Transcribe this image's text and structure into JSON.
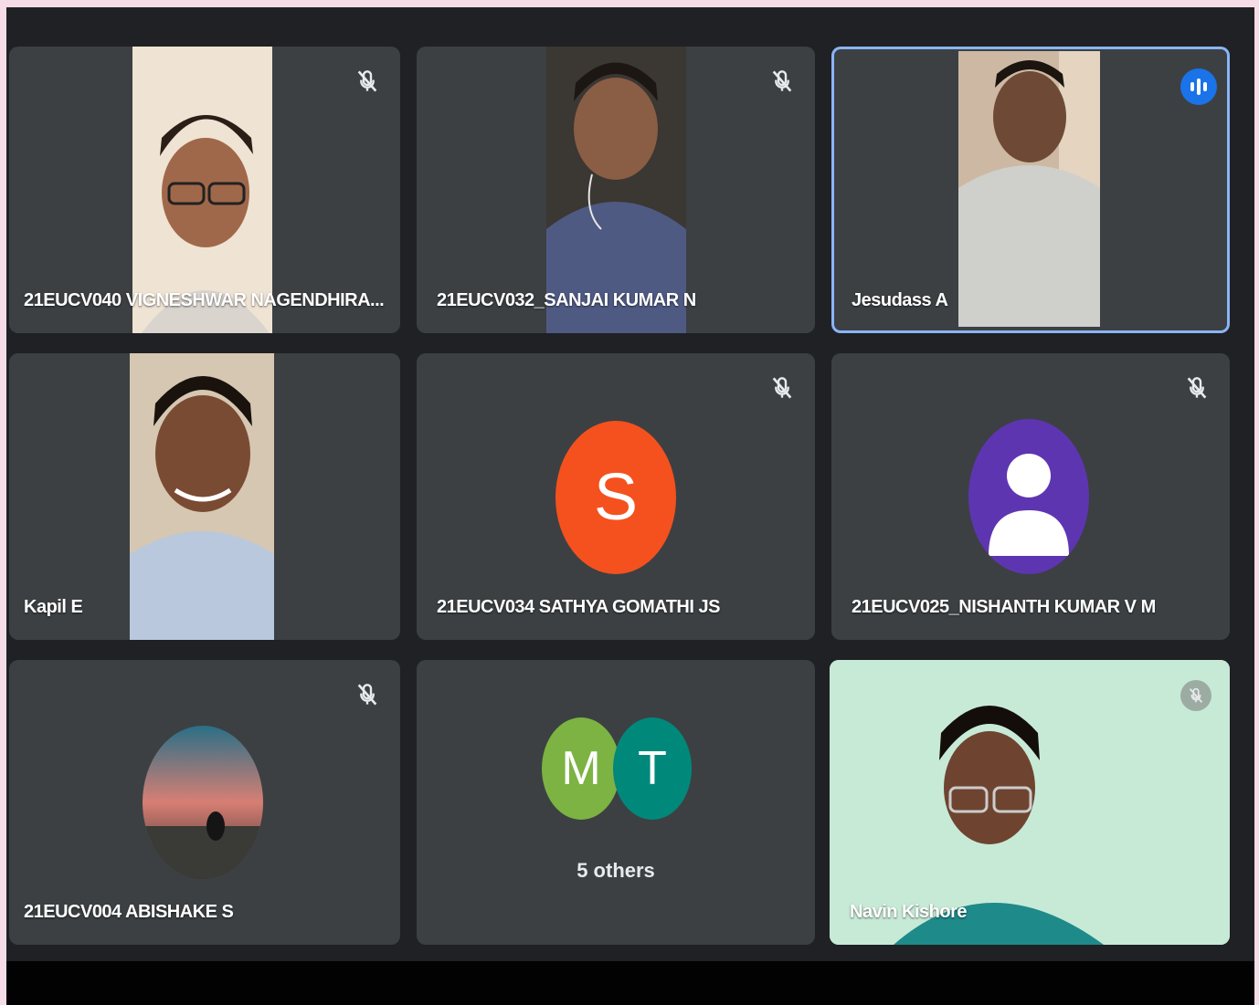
{
  "participants": [
    {
      "name": "21EUCV040 VIGNESHWAR NAGENDHIRA...",
      "muted": true,
      "type": "video"
    },
    {
      "name": "21EUCV032_SANJAI KUMAR N",
      "muted": true,
      "type": "video"
    },
    {
      "name": "Jesudass A",
      "muted": false,
      "speaking": true,
      "type": "video"
    },
    {
      "name": "Kapil E",
      "muted": false,
      "type": "video"
    },
    {
      "name": "21EUCV034 SATHYA GOMATHI JS",
      "muted": true,
      "type": "initial",
      "initial": "S",
      "color": "#f4511e"
    },
    {
      "name": "21EUCV025_NISHANTH KUMAR V M",
      "muted": true,
      "type": "default-avatar",
      "color": "#5e35b1"
    },
    {
      "name": "21EUCV004 ABISHAKE S",
      "muted": true,
      "type": "photo-avatar"
    },
    {
      "name": "Navin Kishore",
      "muted": true,
      "type": "video"
    }
  ],
  "others": {
    "label": "5 others",
    "avatars": [
      {
        "initial": "M",
        "color": "#7cb342"
      },
      {
        "initial": "T",
        "color": "#00897b"
      }
    ]
  },
  "icons": {
    "muted": "mic-off-icon",
    "speaking": "audio-level-icon"
  },
  "colors": {
    "tile_bg": "#3c4043",
    "speaking_border": "#8ab4f8",
    "speaking_badge": "#1a73e8"
  }
}
